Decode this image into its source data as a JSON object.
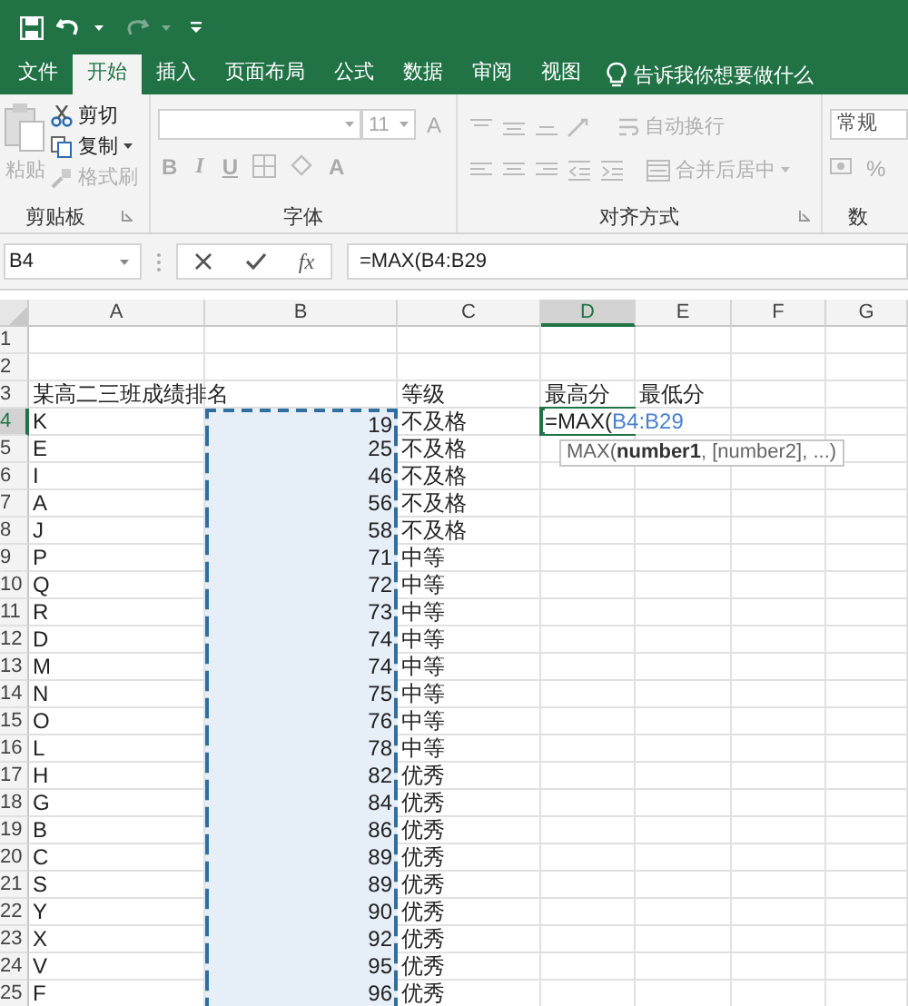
{
  "tabs": [
    {
      "label": "文件",
      "selected": false
    },
    {
      "label": "开始",
      "selected": true
    },
    {
      "label": "插入",
      "selected": false
    },
    {
      "label": "页面布局",
      "selected": false
    },
    {
      "label": "公式",
      "selected": false
    },
    {
      "label": "数据",
      "selected": false
    },
    {
      "label": "审阅",
      "selected": false
    },
    {
      "label": "视图",
      "selected": false
    }
  ],
  "tell_me": "告诉我你想要做什么",
  "clipboard": {
    "label": "剪贴板",
    "paste": {
      "label": "粘贴",
      "disabled": true
    },
    "items": [
      {
        "kind": "cut",
        "label": "剪切",
        "disabled": false
      },
      {
        "kind": "copy",
        "label": "复制",
        "disabled": false
      },
      {
        "kind": "painter",
        "label": "格式刷",
        "disabled": true
      }
    ]
  },
  "font": {
    "label": "字体",
    "size": "11",
    "styles": [
      "B",
      "I",
      "U"
    ],
    "color_letter": "A",
    "grow_letter": "A"
  },
  "alignment": {
    "label": "对齐方式",
    "wrap": {
      "label": "自动换行",
      "disabled": true
    },
    "merge": {
      "label": "合并后居中",
      "disabled": true
    }
  },
  "number": {
    "format": "常规",
    "percent": "%",
    "label": "数"
  },
  "formula_bar": {
    "name_box": "B4",
    "fx": "fx",
    "formula": "=MAX(B4:B29"
  },
  "sheet": {
    "columns": [
      {
        "label": "A",
        "selected": false
      },
      {
        "label": "B",
        "selected": false
      },
      {
        "label": "C",
        "selected": false
      },
      {
        "label": "D",
        "selected": true
      },
      {
        "label": "E",
        "selected": false
      },
      {
        "label": "F",
        "selected": false
      },
      {
        "label": "G",
        "selected": false
      }
    ],
    "edit": {
      "prefix": "=MAX(",
      "reference": "B4:B29",
      "tooltip": "MAX(**number1**, [number2], ...)"
    },
    "rows": [
      {
        "number": "1",
        "selected": false,
        "in_range": false,
        "cells": {}
      },
      {
        "number": "2",
        "selected": false,
        "in_range": false,
        "cells": {}
      },
      {
        "number": "3",
        "selected": false,
        "in_range": false,
        "cells": {
          "a": "某高二三班成绩排名",
          "c": "等级",
          "d": "最高分",
          "e": "最低分"
        }
      },
      {
        "number": "4",
        "selected": true,
        "in_range": true,
        "cells": {
          "a": "K",
          "b": "19",
          "c": "不及格"
        }
      },
      {
        "number": "5",
        "selected": false,
        "in_range": true,
        "cells": {
          "a": "E",
          "b": "25",
          "c": "不及格"
        }
      },
      {
        "number": "6",
        "selected": false,
        "in_range": true,
        "cells": {
          "a": "I",
          "b": "46",
          "c": "不及格"
        }
      },
      {
        "number": "7",
        "selected": false,
        "in_range": true,
        "cells": {
          "a": "A",
          "b": "56",
          "c": "不及格"
        }
      },
      {
        "number": "8",
        "selected": false,
        "in_range": true,
        "cells": {
          "a": "J",
          "b": "58",
          "c": "不及格"
        }
      },
      {
        "number": "9",
        "selected": false,
        "in_range": true,
        "cells": {
          "a": "P",
          "b": "71",
          "c": "中等"
        }
      },
      {
        "number": "10",
        "selected": false,
        "in_range": true,
        "cells": {
          "a": "Q",
          "b": "72",
          "c": "中等"
        }
      },
      {
        "number": "11",
        "selected": false,
        "in_range": true,
        "cells": {
          "a": "R",
          "b": "73",
          "c": "中等"
        }
      },
      {
        "number": "12",
        "selected": false,
        "in_range": true,
        "cells": {
          "a": "D",
          "b": "74",
          "c": "中等"
        }
      },
      {
        "number": "13",
        "selected": false,
        "in_range": true,
        "cells": {
          "a": "M",
          "b": "74",
          "c": "中等"
        }
      },
      {
        "number": "14",
        "selected": false,
        "in_range": true,
        "cells": {
          "a": "N",
          "b": "75",
          "c": "中等"
        }
      },
      {
        "number": "15",
        "selected": false,
        "in_range": true,
        "cells": {
          "a": "O",
          "b": "76",
          "c": "中等"
        }
      },
      {
        "number": "16",
        "selected": false,
        "in_range": true,
        "cells": {
          "a": "L",
          "b": "78",
          "c": "中等"
        }
      },
      {
        "number": "17",
        "selected": false,
        "in_range": true,
        "cells": {
          "a": "H",
          "b": "82",
          "c": "优秀"
        }
      },
      {
        "number": "18",
        "selected": false,
        "in_range": true,
        "cells": {
          "a": "G",
          "b": "84",
          "c": "优秀"
        }
      },
      {
        "number": "19",
        "selected": false,
        "in_range": true,
        "cells": {
          "a": "B",
          "b": "86",
          "c": "优秀"
        }
      },
      {
        "number": "20",
        "selected": false,
        "in_range": true,
        "cells": {
          "a": "C",
          "b": "89",
          "c": "优秀"
        }
      },
      {
        "number": "21",
        "selected": false,
        "in_range": true,
        "cells": {
          "a": "S",
          "b": "89",
          "c": "优秀"
        }
      },
      {
        "number": "22",
        "selected": false,
        "in_range": true,
        "cells": {
          "a": "Y",
          "b": "90",
          "c": "优秀"
        }
      },
      {
        "number": "23",
        "selected": false,
        "in_range": true,
        "cells": {
          "a": "X",
          "b": "92",
          "c": "优秀"
        }
      },
      {
        "number": "24",
        "selected": false,
        "in_range": true,
        "cells": {
          "a": "V",
          "b": "95",
          "c": "优秀"
        }
      },
      {
        "number": "25",
        "selected": false,
        "in_range": true,
        "cells": {
          "a": "F",
          "b": "96",
          "c": "优秀"
        }
      }
    ]
  }
}
